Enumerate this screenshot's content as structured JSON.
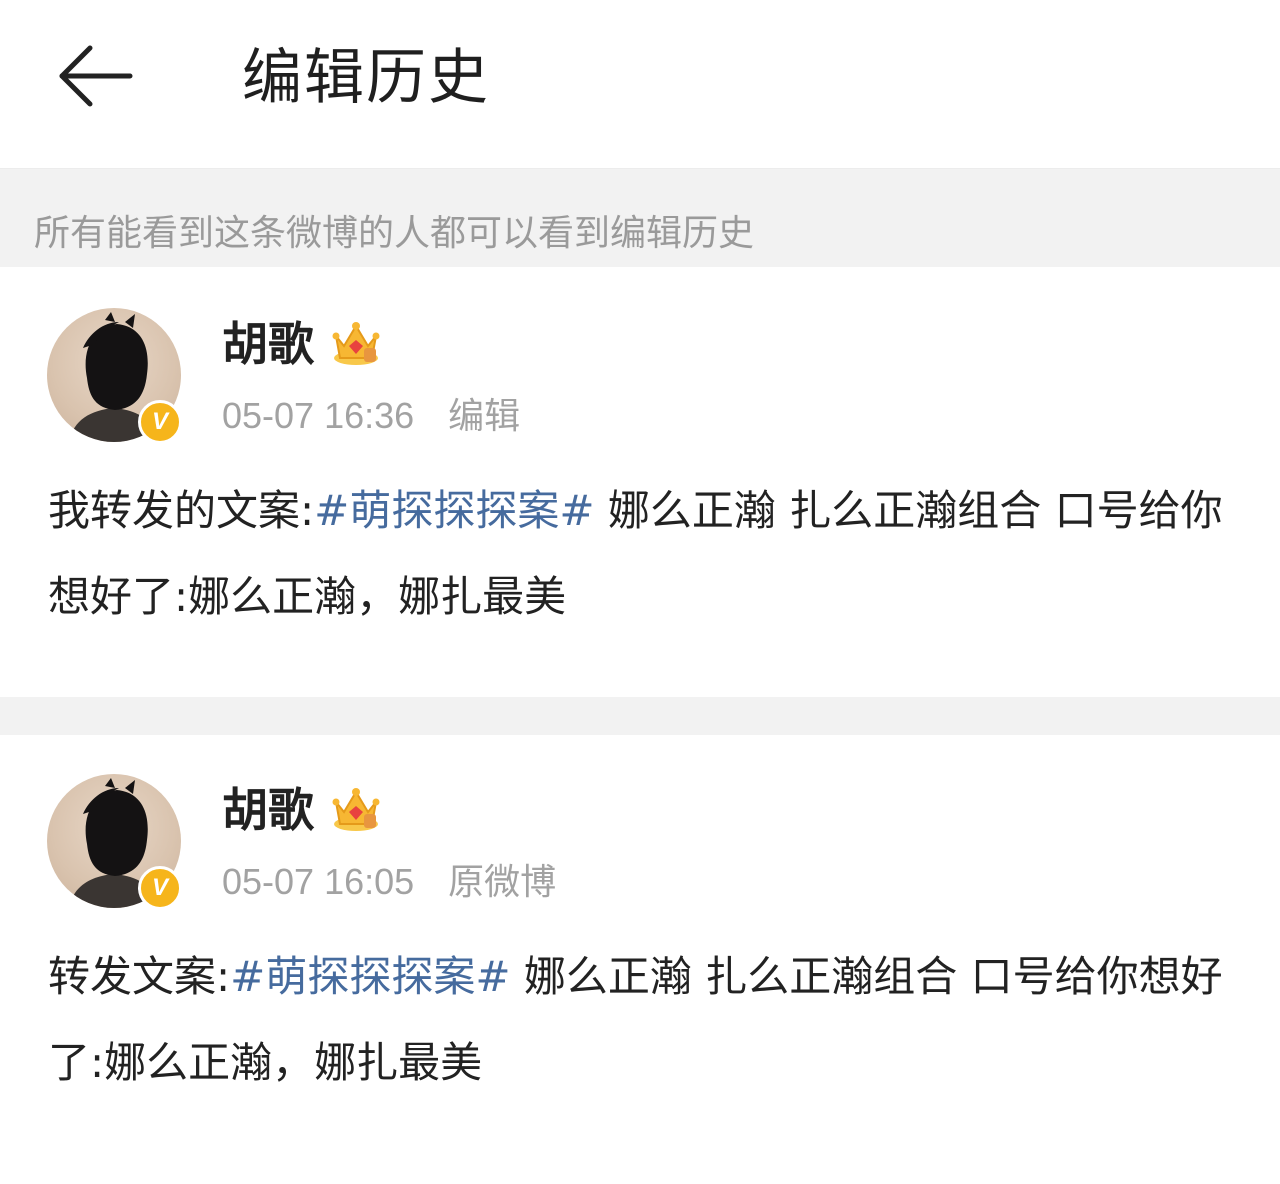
{
  "header": {
    "title": "编辑历史"
  },
  "notice": {
    "text": "所有能看到这条微博的人都可以看到编辑历史"
  },
  "posts": [
    {
      "username": "胡歌",
      "time": "05-07 16:36",
      "label": "编辑",
      "verified_badge": "V",
      "content_prefix": "我转发的文案:",
      "hashtag": "#萌探探探案#",
      "content_suffix": " 娜么正瀚 扎么正瀚组合 口号给你想好了:娜么正瀚，娜扎最美"
    },
    {
      "username": "胡歌",
      "time": "05-07 16:05",
      "label": "原微博",
      "verified_badge": "V",
      "content_prefix": "转发文案:",
      "hashtag": "#萌探探探案#",
      "content_suffix": " 娜么正瀚 扎么正瀚组合 口号给你想好了:娜么正瀚，娜扎最美"
    }
  ],
  "colors": {
    "hashtag": "#466b9e",
    "badge": "#f6b51b",
    "meta_text": "#a2a2a2",
    "band": "#f2f2f2"
  }
}
